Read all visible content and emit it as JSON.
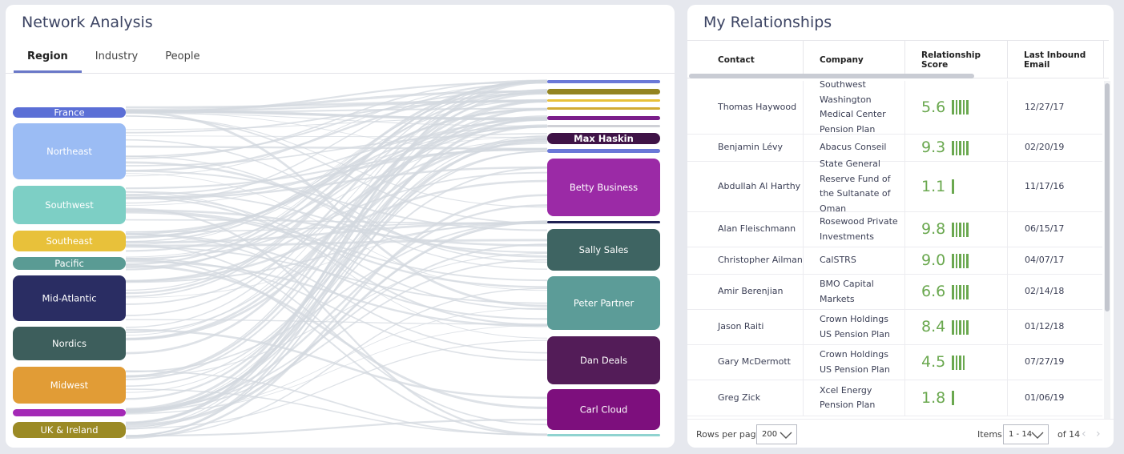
{
  "network": {
    "title": "Network Analysis",
    "tabs": [
      {
        "label": "Region",
        "active": true
      },
      {
        "label": "Industry",
        "active": false
      },
      {
        "label": "People",
        "active": false
      }
    ],
    "regions": [
      {
        "label": "France",
        "color": "#5b6fd6",
        "text": "#ffffff"
      },
      {
        "label": "Northeast",
        "color": "#9bbcf4",
        "text": "#ffffff"
      },
      {
        "label": "Southwest",
        "color": "#7dcfc5",
        "text": "#ffffff"
      },
      {
        "label": "Southeast",
        "color": "#e8c13a",
        "text": "#ffffff"
      },
      {
        "label": "Pacific",
        "color": "#5a9b94",
        "text": "#ffffff"
      },
      {
        "label": "Mid-Atlantic",
        "color": "#2a2d63",
        "text": "#ffffff"
      },
      {
        "label": "Nordics",
        "color": "#3d5e5c",
        "text": "#ffffff"
      },
      {
        "label": "Midwest",
        "color": "#e19c36",
        "text": "#ffffff"
      },
      {
        "label": "",
        "color": "#a429b6",
        "text": "#ffffff"
      },
      {
        "label": "UK & Ireland",
        "color": "#9b8a25",
        "text": "#ffffff"
      }
    ],
    "people": [
      {
        "label": "",
        "color": "#6a78d8"
      },
      {
        "label": "",
        "color": "#938421"
      },
      {
        "label": "",
        "color": "#e8c13a"
      },
      {
        "label": "",
        "color": "#d2ab33"
      },
      {
        "label": "",
        "color": "#7b1e8a"
      },
      {
        "label": "",
        "color": "#cfd0d6"
      },
      {
        "label": "Max Haskin",
        "color": "#3f1347"
      },
      {
        "label": "",
        "color": "#6a78d8"
      },
      {
        "label": "Betty Business",
        "color": "#9b2aa6"
      },
      {
        "label": "",
        "color": "#1e2052"
      },
      {
        "label": "Sally Sales",
        "color": "#3e6462"
      },
      {
        "label": "Peter Partner",
        "color": "#5c9c98"
      },
      {
        "label": "Dan Deals",
        "color": "#531c58"
      },
      {
        "label": "Carl Cloud",
        "color": "#7d0f7d"
      },
      {
        "label": "",
        "color": "#8fd3d0"
      }
    ],
    "flow_color": "#d3d8df"
  },
  "relationships": {
    "title": "My Relationships",
    "columns": [
      "Contact",
      "Company",
      "Relationship Score",
      "Last Inbound Email"
    ],
    "rows": [
      {
        "contact": "Thomas Haywood",
        "company": "Southwest Washington Medical Center Pension Plan",
        "score": "5.6",
        "bars": 5,
        "date": "12/27/17"
      },
      {
        "contact": "Benjamin Lévy",
        "company": "Abacus Conseil",
        "score": "9.3",
        "bars": 5,
        "date": "02/20/19"
      },
      {
        "contact": "Abdullah Al Harthy",
        "company": "State General Reserve Fund of the Sultanate of Oman",
        "score": "1.1",
        "bars": 1,
        "date": "11/17/16"
      },
      {
        "contact": "Alan Fleischmann",
        "company": "Rosewood Private Investments",
        "score": "9.8",
        "bars": 5,
        "date": "06/15/17"
      },
      {
        "contact": "Christopher Ailman",
        "company": "CalSTRS",
        "score": "9.0",
        "bars": 5,
        "date": "04/07/17"
      },
      {
        "contact": "Amir Berenjian",
        "company": "BMO Capital Markets",
        "score": "6.6",
        "bars": 5,
        "date": "02/14/18"
      },
      {
        "contact": "Jason Raiti",
        "company": "Crown Holdings US Pension Plan",
        "score": "8.4",
        "bars": 5,
        "date": "01/12/18"
      },
      {
        "contact": "Gary McDermott",
        "company": "Crown Holdings US Pension Plan",
        "score": "4.5",
        "bars": 4,
        "date": "07/27/19"
      },
      {
        "contact": "Greg Zick",
        "company": "Xcel Energy Pension Plan",
        "score": "1.8",
        "bars": 1,
        "date": "01/06/19"
      }
    ],
    "footer": {
      "rows_per_page_label": "Rows per page",
      "rows_per_page_value": "200",
      "items_label": "Items",
      "items_value": "1 - 14",
      "of_label": "of 14",
      "prev_icon": "chevron-left-icon",
      "next_icon": "chevron-right-icon"
    },
    "score_color": "#6aa84f"
  }
}
